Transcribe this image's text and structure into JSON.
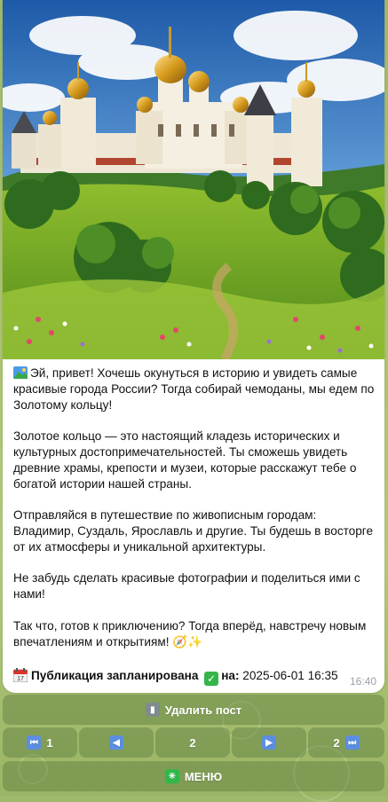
{
  "message": {
    "paragraphs": [
      "Эй, привет! Хочешь окунуться в историю и увидеть самые красивые города России? Тогда собирай чемоданы, мы едем по Золотому кольцу!",
      "Золотое кольцо — это настоящий кладезь исторических и культурных достопримечательностей. Ты сможешь увидеть древние храмы, крепости и музеи, которые расскажут тебе о богатой истории нашей страны.",
      "Отправляйся в путешествие по живописным городам: Владимир, Суздаль, Ярославль и другие. Ты будешь в восторге от их атмосферы и уникальной архитектуры.",
      "Не забудь сделать красивые фотографии и поделиться ими с нами!",
      "Так что, готов к приключению? Тогда вперёд, навстречу новым впечатлениям и открытиям! 🧭✨"
    ],
    "schedule_label": "Публикация запланирована",
    "schedule_on": "на:",
    "schedule_datetime": "2025-06-01 16:35",
    "time": "16:40"
  },
  "keyboard": {
    "delete_label": "Удалить пост",
    "first_page": "1",
    "current_page": "2",
    "last_page": "2",
    "menu_label": "МЕНЮ"
  },
  "icons": {
    "first": "rewind-icon",
    "prev": "play-left-icon",
    "next": "play-right-icon",
    "last": "fast-forward-icon",
    "delete": "trash-icon",
    "menu": "asterisk-icon",
    "calendar": "calendar-icon",
    "check": "check-mark-icon",
    "picture": "picture-icon"
  }
}
